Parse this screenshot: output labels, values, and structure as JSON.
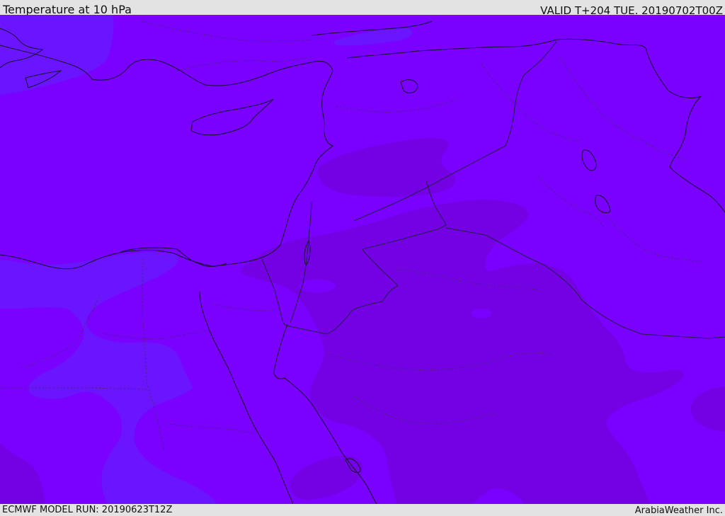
{
  "header": {
    "title": "Temperature at 10 hPa",
    "valid": "VALID T+204 TUE. 20190702T00Z"
  },
  "footer": {
    "model_run": "ECMWF MODEL RUN: 20190623T12Z",
    "brand": "ArabiaWeather Inc."
  },
  "colors": {
    "frame": "#e3e3e3",
    "base_field": "#7a00ff",
    "warm_field": "#7400e4",
    "cool_field": "#6a14ff",
    "coastline": "#141430",
    "border": "#222244"
  }
}
